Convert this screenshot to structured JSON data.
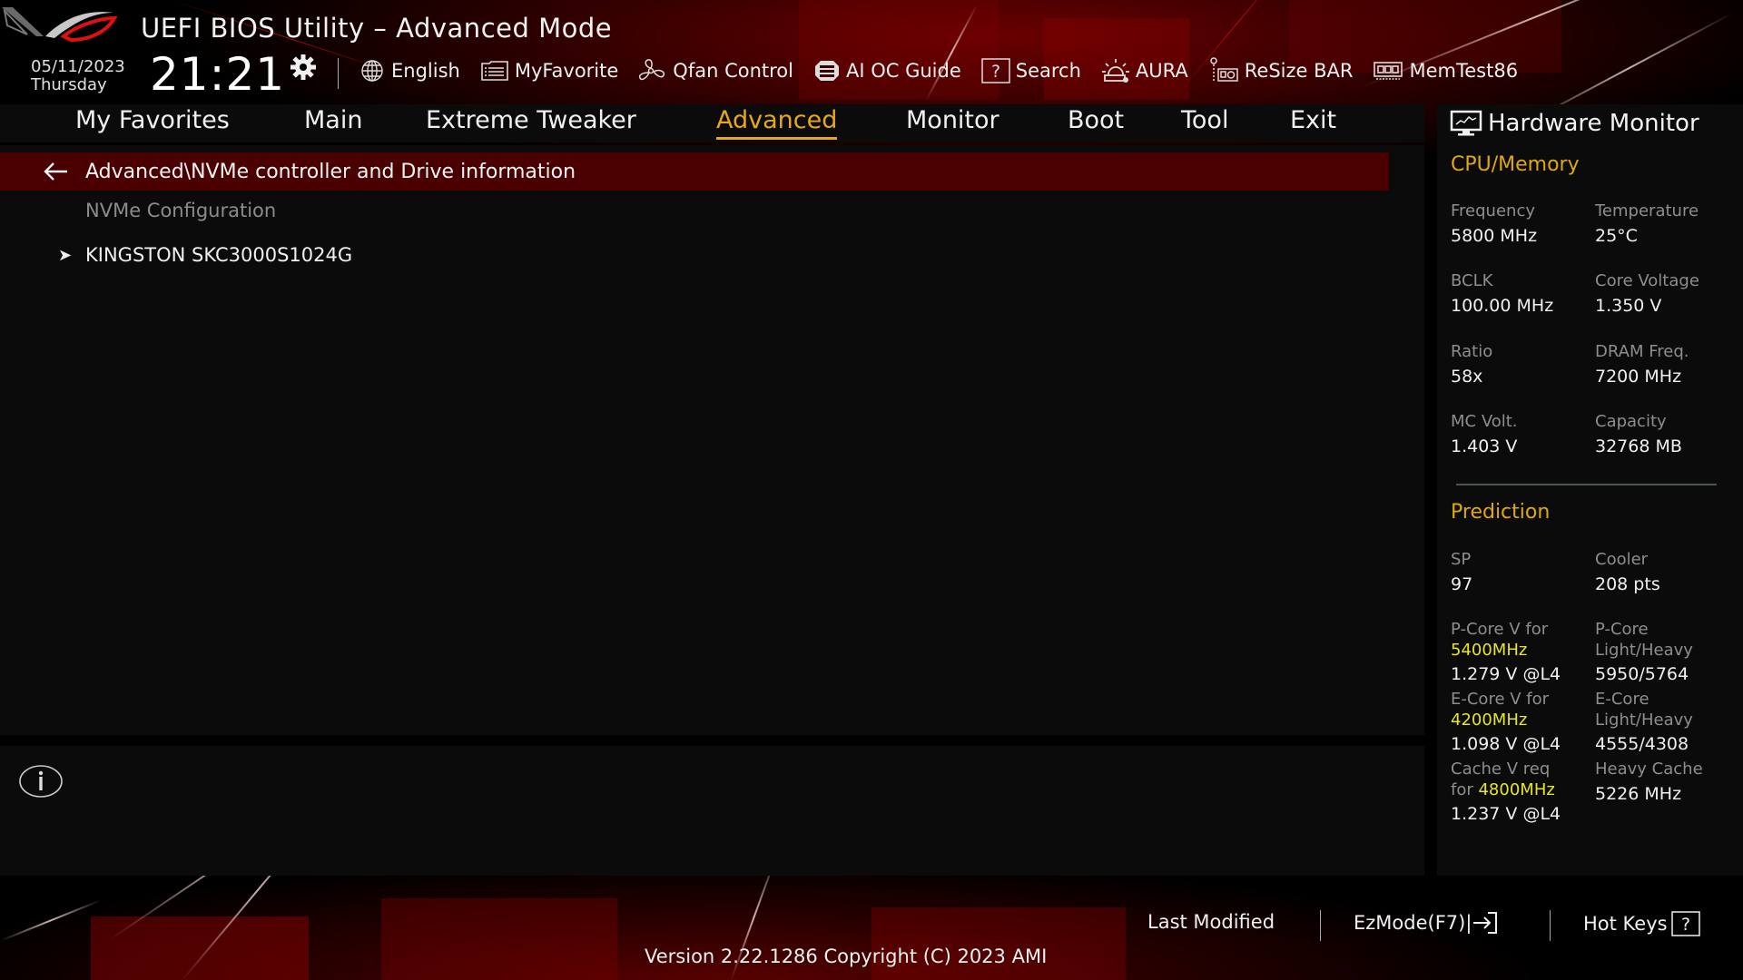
{
  "header": {
    "app_title": "UEFI BIOS Utility – Advanced Mode",
    "date": "05/11/2023",
    "weekday": "Thursday",
    "time": "21:21",
    "toolbar": [
      {
        "label": "English",
        "icon": "globe-icon"
      },
      {
        "label": "MyFavorite",
        "icon": "favorite-list-icon"
      },
      {
        "label": "Qfan Control",
        "icon": "fan-icon"
      },
      {
        "label": "AI OC Guide",
        "icon": "ai-chip-icon"
      },
      {
        "label": "Search",
        "icon": "question-box-icon"
      },
      {
        "label": "AURA",
        "icon": "aura-light-icon"
      },
      {
        "label": "ReSize BAR",
        "icon": "gpu-card-icon"
      },
      {
        "label": "MemTest86",
        "icon": "memory-module-icon"
      }
    ]
  },
  "nav": {
    "tabs": [
      {
        "label": "My Favorites",
        "active": false
      },
      {
        "label": "Main",
        "active": false
      },
      {
        "label": "Extreme Tweaker",
        "active": false
      },
      {
        "label": "Advanced",
        "active": true
      },
      {
        "label": "Monitor",
        "active": false
      },
      {
        "label": "Boot",
        "active": false
      },
      {
        "label": "Tool",
        "active": false
      },
      {
        "label": "Exit",
        "active": false
      }
    ]
  },
  "main": {
    "breadcrumb": "Advanced\\NVMe controller and Drive information",
    "items": [
      {
        "label": "NVMe Configuration",
        "type": "header"
      },
      {
        "label": "KINGSTON SKC3000S1024G",
        "type": "submenu"
      }
    ]
  },
  "hardware_monitor": {
    "title": "Hardware Monitor",
    "cpu_memory": {
      "section": "CPU/Memory",
      "rows": [
        {
          "left_label": "Frequency",
          "left_value": "5800 MHz",
          "right_label": "Temperature",
          "right_value": "25°C"
        },
        {
          "left_label": "BCLK",
          "left_value": "100.00 MHz",
          "right_label": "Core Voltage",
          "right_value": "1.350 V"
        },
        {
          "left_label": "Ratio",
          "left_value": "58x",
          "right_label": "DRAM Freq.",
          "right_value": "7200 MHz"
        },
        {
          "left_label": "MC Volt.",
          "left_value": "1.403 V",
          "right_label": "Capacity",
          "right_value": "32768 MB"
        }
      ]
    },
    "prediction": {
      "section": "Prediction",
      "sp_label": "SP",
      "sp_value": "97",
      "cooler_label": "Cooler",
      "cooler_value": "208 pts",
      "pcore_v_label": "P-Core V for",
      "pcore_v_freq": "5400MHz",
      "pcore_v_value": "1.279 V @L4",
      "pcore_lh_label_1": "P-Core",
      "pcore_lh_label_2": "Light/Heavy",
      "pcore_lh_value": "5950/5764",
      "ecore_v_label": "E-Core V for",
      "ecore_v_freq": "4200MHz",
      "ecore_v_value": "1.098 V @L4",
      "ecore_lh_label_1": "E-Core",
      "ecore_lh_label_2": "Light/Heavy",
      "ecore_lh_value": "4555/4308",
      "cache_v_label_1": "Cache V req",
      "cache_v_label_2": "for",
      "cache_v_freq": "4800MHz",
      "cache_v_value": "1.237 V @L4",
      "heavy_cache_label": "Heavy Cache",
      "heavy_cache_value": "5226 MHz"
    }
  },
  "footer": {
    "last_modified": "Last Modified",
    "ezmode": "EzMode(F7)|",
    "hotkeys": "Hot Keys",
    "version": "Version 2.22.1286 Copyright (C) 2023 AMI"
  },
  "colors": {
    "accent": "#e8a815",
    "highlight": "#e6e61a",
    "breadcrumb_bg": "#4a0000",
    "panel_bg": "#0b0b0b"
  }
}
